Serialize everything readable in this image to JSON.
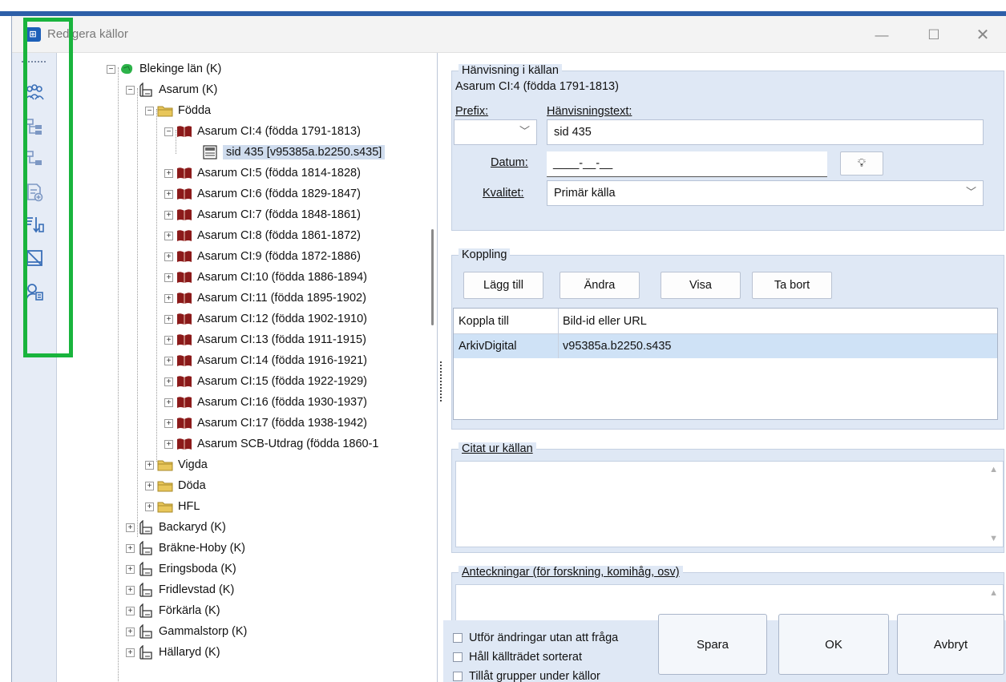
{
  "window": {
    "title": "Redigera källor"
  },
  "toolbar": {
    "items": [
      {
        "icon": "people-icon"
      },
      {
        "icon": "tree-structure-icon"
      },
      {
        "icon": "tree-child-icon"
      },
      {
        "icon": "add-document-icon"
      },
      {
        "icon": "sort-icon"
      },
      {
        "icon": "delete-frame-icon"
      },
      {
        "icon": "search-person-icon"
      }
    ]
  },
  "tree": {
    "rows": [
      {
        "label": "Blekinge län (K)",
        "icon": "region-icon",
        "expander": "⊟"
      },
      {
        "label": "Asarum (K)",
        "icon": "church-icon",
        "expander": "⊟"
      },
      {
        "label": "Födda",
        "icon": "folder-icon",
        "expander": "⊟"
      },
      {
        "label": "Asarum CI:4 (födda 1791-1813)",
        "icon": "book-icon",
        "expander": "⊟"
      },
      {
        "label": "sid 435 [v95385a.b2250.s435]",
        "icon": "page-icon",
        "expander": ""
      },
      {
        "label": "Asarum CI:5 (födda 1814-1828)",
        "icon": "book-icon",
        "expander": "⊞"
      },
      {
        "label": "Asarum CI:6 (födda 1829-1847)",
        "icon": "book-icon",
        "expander": "⊞"
      },
      {
        "label": "Asarum CI:7 (födda 1848-1861)",
        "icon": "book-icon",
        "expander": "⊞"
      },
      {
        "label": "Asarum CI:8 (födda 1861-1872)",
        "icon": "book-icon",
        "expander": "⊞"
      },
      {
        "label": "Asarum CI:9 (födda 1872-1886)",
        "icon": "book-icon",
        "expander": "⊞"
      },
      {
        "label": "Asarum CI:10 (födda 1886-1894)",
        "icon": "book-icon",
        "expander": "⊞"
      },
      {
        "label": "Asarum CI:11 (födda 1895-1902)",
        "icon": "book-icon",
        "expander": "⊞"
      },
      {
        "label": "Asarum CI:12 (födda 1902-1910)",
        "icon": "book-icon",
        "expander": "⊞"
      },
      {
        "label": "Asarum CI:13 (födda 1911-1915)",
        "icon": "book-icon",
        "expander": "⊞"
      },
      {
        "label": "Asarum CI:14 (födda 1916-1921)",
        "icon": "book-icon",
        "expander": "⊞"
      },
      {
        "label": "Asarum CI:15 (födda 1922-1929)",
        "icon": "book-icon",
        "expander": "⊞"
      },
      {
        "label": "Asarum CI:16 (födda 1930-1937)",
        "icon": "book-icon",
        "expander": "⊞"
      },
      {
        "label": "Asarum CI:17 (födda 1938-1942)",
        "icon": "book-icon",
        "expander": "⊞"
      },
      {
        "label": "Asarum SCB-Utdrag (födda 1860-1",
        "icon": "book-icon",
        "expander": "⊞"
      },
      {
        "label": "Vigda",
        "icon": "folder-icon",
        "expander": "⊞"
      },
      {
        "label": "Döda",
        "icon": "folder-icon",
        "expander": "⊞"
      },
      {
        "label": "HFL",
        "icon": "folder-icon",
        "expander": "⊞"
      },
      {
        "label": "Backaryd (K)",
        "icon": "church-icon",
        "expander": "⊞"
      },
      {
        "label": "Bräkne-Hoby (K)",
        "icon": "church-icon",
        "expander": "⊞"
      },
      {
        "label": "Eringsboda (K)",
        "icon": "church-icon",
        "expander": "⊞"
      },
      {
        "label": "Fridlevstad (K)",
        "icon": "church-icon",
        "expander": "⊞"
      },
      {
        "label": "Förkärla (K)",
        "icon": "church-icon",
        "expander": "⊞"
      },
      {
        "label": "Gammalstorp (K)",
        "icon": "church-icon",
        "expander": "⊞"
      },
      {
        "label": "Hällaryd (K)",
        "icon": "church-icon",
        "expander": "⊞"
      }
    ]
  },
  "reference": {
    "group_title": "Hänvisning i källan",
    "source_name": "Asarum CI:4 (födda 1791-1813)",
    "prefix_label": "Prefix:",
    "prefix_value": "",
    "text_label": "Hänvisningstext:",
    "text_value": "sid 435",
    "date_label": "Datum:",
    "date_value": "____-__-__",
    "quality_label": "Kvalitet:",
    "quality_value": "Primär källa"
  },
  "link": {
    "group_title": "Koppling",
    "buttons": {
      "add": "Lägg till",
      "edit": "Ändra",
      "show": "Visa",
      "remove": "Ta bort"
    },
    "columns": [
      "Koppla till",
      "Bild-id eller URL"
    ],
    "rows": [
      {
        "target": "ArkivDigital",
        "id": "v95385a.b2250.s435"
      }
    ]
  },
  "quote": {
    "group_title": "Citat ur källan",
    "value": ""
  },
  "notes": {
    "group_title": "Anteckningar (för forskning, komihåg, osv)",
    "value": ""
  },
  "options": {
    "no_confirm": "Utför ändringar utan att fråga",
    "keep_sorted": "Håll källträdet sorterat",
    "allow_groups": "Tillåt grupper under källor"
  },
  "actions": {
    "save": "Spara",
    "ok": "OK",
    "cancel": "Avbryt"
  },
  "colors": {
    "highlight": "#19b43d",
    "panel": "#dfe8f5",
    "selection": "#cfe2f6"
  }
}
